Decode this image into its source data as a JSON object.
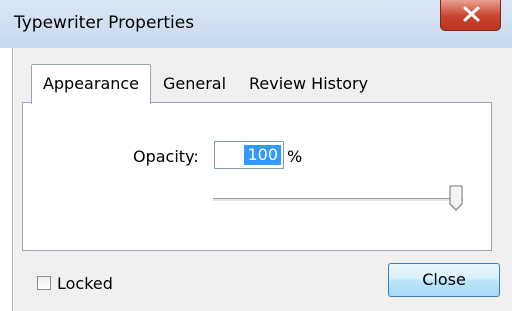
{
  "window": {
    "title": "Typewriter Properties",
    "close_icon": "close-x-icon"
  },
  "tabs": [
    {
      "label": "Appearance",
      "active": true
    },
    {
      "label": "General",
      "active": false
    },
    {
      "label": "Review History",
      "active": false
    }
  ],
  "appearance": {
    "opacity_label": "Opacity:",
    "opacity_value": "100",
    "opacity_unit": "%",
    "opacity_slider_percent": 100
  },
  "footer": {
    "locked_label": "Locked",
    "locked_checked": false,
    "close_label": "Close"
  },
  "colors": {
    "selection": "#3399ff",
    "close_button_border": "#3c7fb1",
    "title_close_red": "#c7432d"
  }
}
